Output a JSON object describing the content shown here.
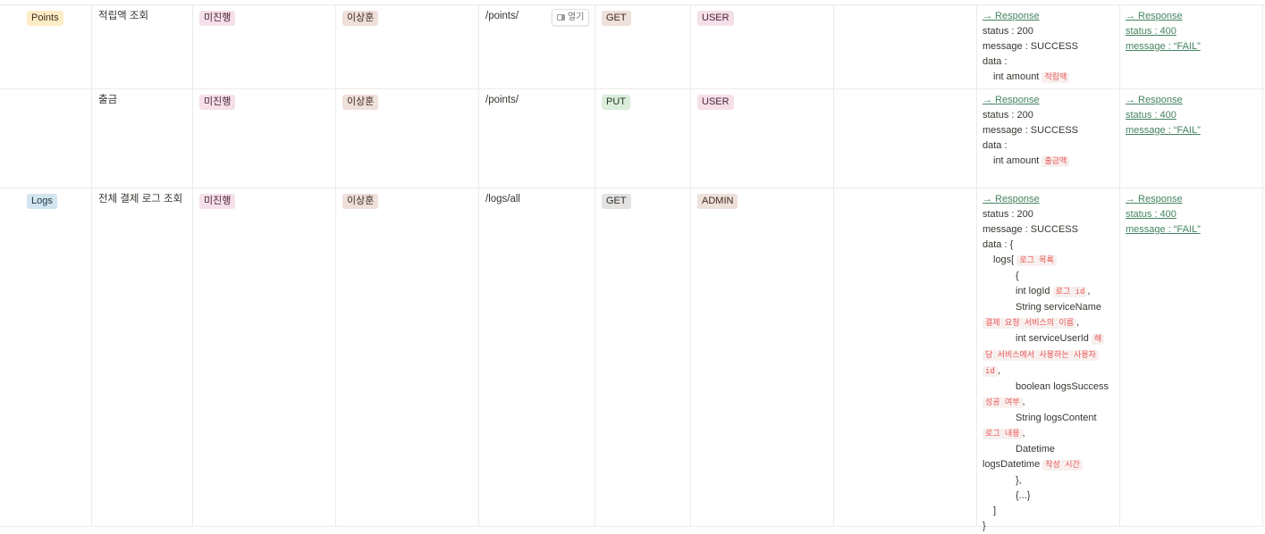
{
  "rows": [
    {
      "category": "Points",
      "name": "적립액 조회",
      "status": "미진행",
      "assignee": "이상훈",
      "url": "/points/",
      "method": "GET",
      "role": "USER",
      "open_label": "열기",
      "success": {
        "header": "→ Response",
        "lines": [
          "status : 200",
          "message : SUCCESS",
          "data :"
        ],
        "field": "int amount",
        "field_code": "적립액"
      },
      "fail": {
        "header": "→ Response",
        "status": "status : 400",
        "message": "message : “FAIL”"
      }
    },
    {
      "category": "",
      "name": "출금",
      "status": "미진행",
      "assignee": "이상훈",
      "url": "/points/",
      "method": "PUT",
      "role": "USER",
      "success": {
        "header": "→ Response",
        "lines": [
          "status : 200",
          "message : SUCCESS",
          "data :"
        ],
        "field": "int amount",
        "field_code": "출금액"
      },
      "fail": {
        "header": "→ Response",
        "status": "status : 400",
        "message": "message : “FAIL”"
      }
    },
    {
      "category": "Logs",
      "name": "전체 결제 로그 조회",
      "status": "미진행",
      "assignee": "이상훈",
      "url": "/logs/all",
      "method": "GET",
      "role": "ADMIN",
      "success": {
        "header": "→ Response",
        "status": "status : 200",
        "message": "message : SUCCESS",
        "data": "data : {",
        "logs_open": "logs[",
        "logs_code": "로그 목록",
        "brace_open": "{",
        "f1": "int logId",
        "f1_code": "로그 id",
        "f2": "String serviceName",
        "f2_code": "결제 요청 서비스의 이름",
        "f3": "int serviceUserId",
        "f3_code_a": "해",
        "f3_code_b": "당 서비스에서 사용하는 사용자",
        "f3_code_c": "id",
        "f4": "boolean logsSuccess",
        "f4_code": "성공 여부",
        "f5": "String logsContent",
        "f5_code": "로그 내용",
        "f6a": "Datetime",
        "f6b": "logsDatetime",
        "f6_code": "작성 시간",
        "brace_close": "},",
        "ellipsis": "{...}",
        "bracket_close": "]",
        "final_close": "}",
        "comma": ","
      },
      "fail": {
        "header": "→ Response",
        "status": "status : 400",
        "message": "message : “FAIL”"
      }
    }
  ]
}
